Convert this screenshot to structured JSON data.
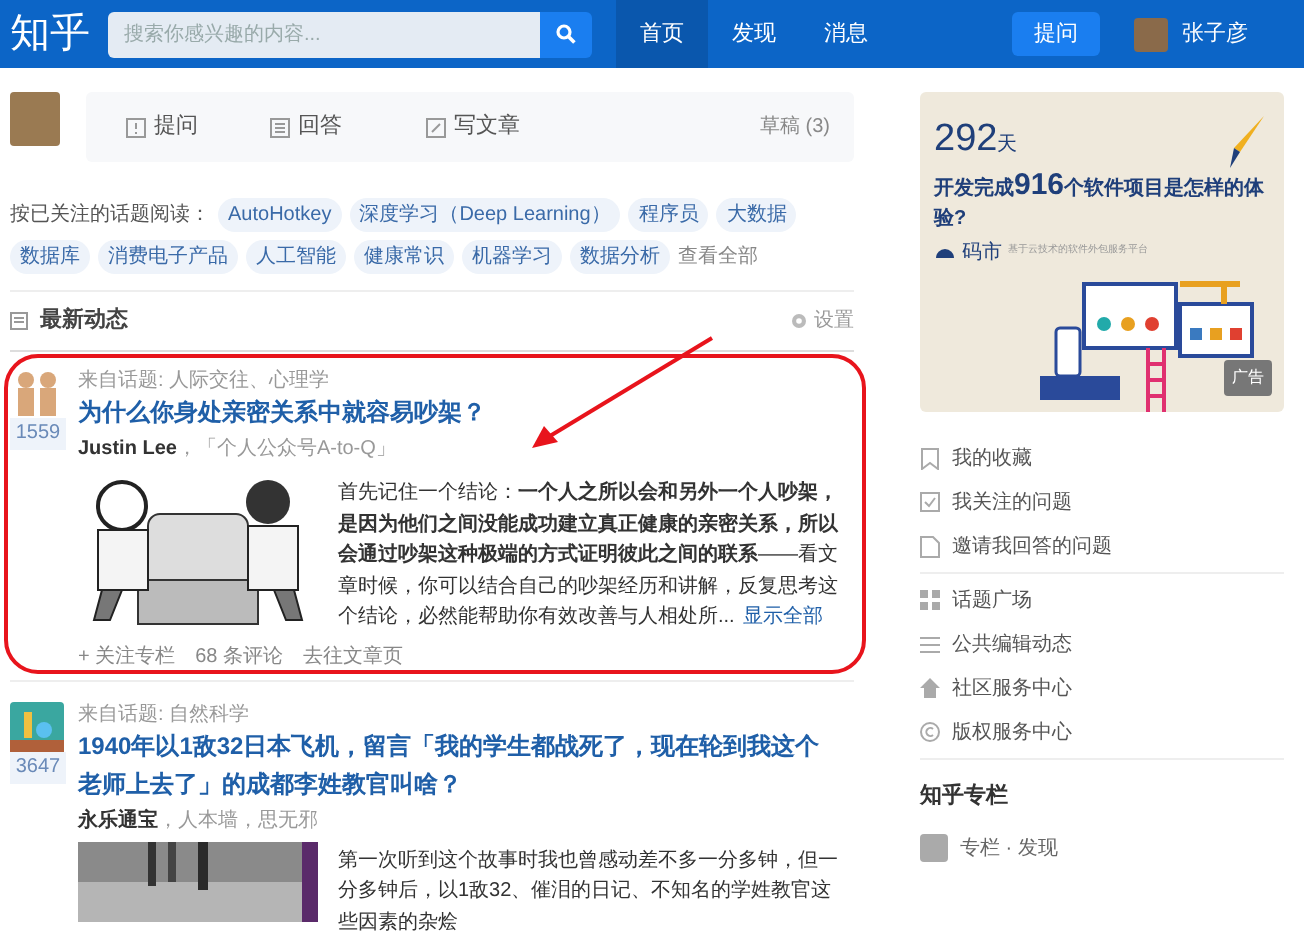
{
  "header": {
    "logo": "知乎",
    "search": {
      "placeholder": "搜索你感兴趣的内容..."
    },
    "nav": [
      {
        "label": "首页",
        "selected": true
      },
      {
        "label": "发现",
        "selected": false
      },
      {
        "label": "消息",
        "selected": false
      }
    ],
    "ask_button": "提问",
    "user": "张子彦"
  },
  "composer": {
    "actions": [
      "提问",
      "回答",
      "写文章"
    ],
    "drafts": "草稿 (3)"
  },
  "topics": {
    "label": "按已关注的话题阅读：",
    "items": [
      "AutoHotkey",
      "深度学习（Deep Learning）",
      "程序员",
      "大数据",
      "数据库",
      "消费电子产品",
      "人工智能",
      "健康常识",
      "机器学习",
      "数据分析"
    ],
    "more": "查看全部"
  },
  "feed": {
    "title": "最新动态",
    "settings": "设置",
    "posts": [
      {
        "topic": "来自话题: 人际交往、心理学",
        "title": "为什么你身处亲密关系中就容易吵架？",
        "votes": "1559",
        "author": "Justin Lee",
        "sep": "，",
        "bio": "「个人公众号A-to-Q」",
        "body": "首先记住一个结论：**一个人之所以会和另外一个人吵架，是因为他们之间没能成功建立真正健康的亲密关系，所以会通过吵架这种极端的方式证明彼此之间的联系**——看文章时候，你可以结合自己的吵架经历和讲解，反复思考这个结论，必然能帮助你有效改善与人相处所...",
        "more": "显示全部",
        "footer": [
          "+ 关注专栏",
          "68 条评论",
          "去往文章页"
        ]
      },
      {
        "topic": "来自话题: 自然科学",
        "title": "1940年以1敌32日本飞机，留言「我的学生都战死了，现在轮到我这个老师上去了」的成都李姓教官叫啥？",
        "votes": "3647",
        "author": "永乐通宝",
        "sep": "，",
        "bio": "人本墙，思无邪",
        "body": "第一次听到这个故事时我也曾感动差不多一分多钟，但一分多钟后，以1敌32、催泪的日记、不知名的学姓教官这些因素的杂烩"
      }
    ]
  },
  "ad": {
    "days": "292",
    "days_unit": "天",
    "line_pre": "开发完成",
    "line_num": "916",
    "line_post": "个软件项目是怎样的体验?",
    "brand": "码市",
    "tagline": "基于云技术的软件外包服务平台",
    "badge": "广告"
  },
  "side_links": [
    [
      {
        "kind": "bookmark",
        "label": "我的收藏"
      },
      {
        "kind": "check",
        "label": "我关注的问题"
      },
      {
        "kind": "doc",
        "label": "邀请我回答的问题"
      }
    ],
    [
      {
        "kind": "grid",
        "label": "话题广场"
      },
      {
        "kind": "list",
        "label": "公共编辑动态"
      },
      {
        "kind": "home",
        "label": "社区服务中心"
      },
      {
        "kind": "copyright",
        "label": "版权服务中心"
      }
    ]
  ],
  "column": {
    "title": "知乎专栏",
    "item": "专栏 · 发现"
  }
}
